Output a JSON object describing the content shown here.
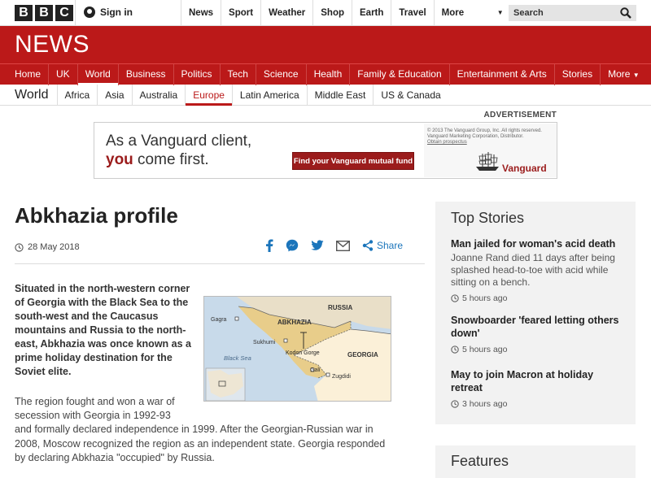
{
  "brand": {
    "letters": [
      "B",
      "B",
      "C"
    ],
    "news_title": "NEWS"
  },
  "topbar": {
    "signin": "Sign in",
    "nav": [
      "News",
      "Sport",
      "Weather",
      "Shop",
      "Earth",
      "Travel",
      "More"
    ],
    "search_placeholder": "Search"
  },
  "mainnav": [
    "Home",
    "UK",
    "World",
    "Business",
    "Politics",
    "Tech",
    "Science",
    "Health",
    "Family & Education",
    "Entertainment & Arts",
    "Stories",
    "More"
  ],
  "subnav": {
    "section": "World",
    "items": [
      "Africa",
      "Asia",
      "Australia",
      "Europe",
      "Latin America",
      "Middle East",
      "US & Canada"
    ]
  },
  "ad": {
    "label": "ADVERTISEMENT",
    "line1": "As a Vanguard client,",
    "line2_bold": "you",
    "line2_rest": " come first.",
    "button": "Find your Vanguard mutual fund",
    "fine1": "© 2013 The Vanguard Group, Inc. All rights reserved.",
    "fine2": "Vanguard Marketing Corporation, Distributor.",
    "fine3": "Obtain prospectus",
    "brand": "Vanguard"
  },
  "article": {
    "headline": "Abkhazia profile",
    "date": "28 May 2018",
    "share_label": "Share",
    "lede": "Situated in the north-western corner of Georgia with the Black Sea to the south-west and the Caucasus mountains and Russia to the north-east, Abkhazia was once known as a prime holiday destination for the Soviet elite.",
    "para1": "The region fought and won a war of secession with Georgia in 1992-93",
    "para2": "and formally declared independence in 1999. After the Georgian-Russian war in 2008, Moscow recognized the region as an independent state. Georgia responded by declaring Abkhazia \"occupied\" by Russia."
  },
  "map": {
    "labels": {
      "russia": "RUSSIA",
      "abkhazia": "ABKHAZIA",
      "gagra": "Gagra",
      "sukhumi": "Sukhumi",
      "kodori": "Kodori Gorge",
      "georgia": "GEORGIA",
      "black_sea": "Black Sea",
      "gali": "Gali",
      "zugdidi": "Zugdidi"
    }
  },
  "sidebar": {
    "title": "Top Stories",
    "stories": [
      {
        "headline": "Man jailed for woman's acid death",
        "summary": "Joanne Rand died 11 days after being splashed head-to-toe with acid while sitting on a bench.",
        "time": "5 hours ago"
      },
      {
        "headline": "Snowboarder 'feared letting others down'",
        "summary": "",
        "time": "5 hours ago"
      },
      {
        "headline": "May to join Macron at holiday retreat",
        "summary": "",
        "time": "3 hours ago"
      }
    ],
    "features_title": "Features"
  },
  "colors": {
    "bbc_red": "#bb1919",
    "vanguard_red": "#9b1c1c",
    "share_blue": "#1b75bb"
  }
}
